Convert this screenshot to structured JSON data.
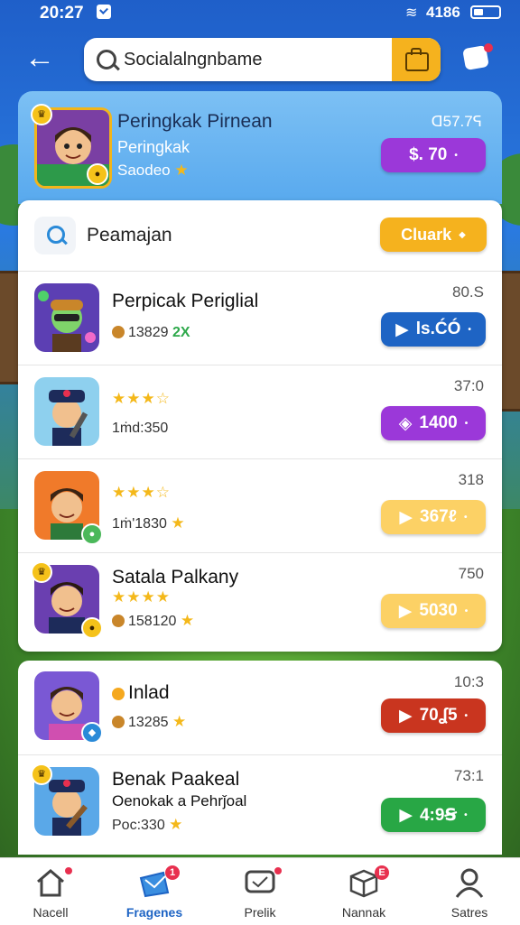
{
  "status": {
    "time": "20:27",
    "signal": "4186"
  },
  "topbar": {
    "search_value": "Socialalngnbame"
  },
  "profile": {
    "title": "Peringkak Pirnean",
    "subtitle": "Peringkak",
    "meta": "Saodeo",
    "score": "ᗡ57.7ᕋ",
    "pill_label": "$. 70"
  },
  "filter": {
    "text": "Peamajan",
    "button_label": "Cluark"
  },
  "rows": [
    {
      "title": "Perpicak Periglial",
      "meta": "13829",
      "extra": "2X",
      "rank": "80.S",
      "pill": "ls.ĆÓ",
      "color": "blue"
    },
    {
      "title": "",
      "meta": "1ṁd:350",
      "rank": "37:0",
      "pill": "1400",
      "color": "purple",
      "rating": 4
    },
    {
      "title": "",
      "meta": "1ṁ'1830",
      "rank": "318",
      "pill": "367ℓ",
      "color": "yellow",
      "rating": 4
    },
    {
      "title": "Satala Palkany",
      "meta": "158120",
      "rank": "750",
      "pill": "5030",
      "color": "yellow",
      "rating": 4
    }
  ],
  "rows2": [
    {
      "title": "Inlad",
      "meta": "13285",
      "rank": "10:3",
      "pill": "70ʆ5",
      "color": "red"
    },
    {
      "title": "Benak Paakeal",
      "subtitle": "Oenokak a Pehrǰoal",
      "meta": "Poc:330",
      "rank": "73:1",
      "pill": "4:9Ꞩ",
      "color": "green"
    }
  ],
  "nav": [
    {
      "label": "Nacell",
      "icon": "home-icon"
    },
    {
      "label": "Fragenes",
      "icon": "folder-icon",
      "badge": "1",
      "active": true
    },
    {
      "label": "Prelik",
      "icon": "chat-icon"
    },
    {
      "label": "Nannak",
      "icon": "box-icon",
      "badge": "E"
    },
    {
      "label": "Satres",
      "icon": "profile-icon"
    }
  ],
  "colors": {
    "accent_blue": "#1e64c4",
    "purple": "#9b38d9",
    "yellow": "#f5b21e",
    "red": "#c9351f",
    "green": "#28a745"
  }
}
